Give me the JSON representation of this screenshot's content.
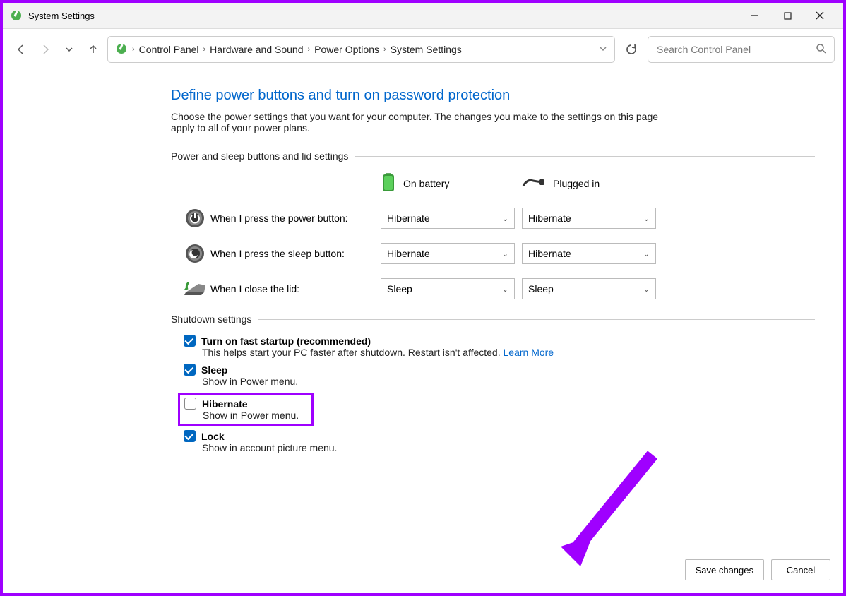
{
  "window": {
    "title": "System Settings"
  },
  "breadcrumb": {
    "items": [
      "Control Panel",
      "Hardware and Sound",
      "Power Options",
      "System Settings"
    ]
  },
  "search": {
    "placeholder": "Search Control Panel"
  },
  "page": {
    "heading": "Define power buttons and turn on password protection",
    "description": "Choose the power settings that you want for your computer. The changes you make to the settings on this page apply to all of your power plans.",
    "section_power_label": "Power and sleep buttons and lid settings",
    "col_battery": "On battery",
    "col_plugged": "Plugged in",
    "rows": {
      "power_button": {
        "label": "When I press the power button:",
        "battery": "Hibernate",
        "plugged": "Hibernate"
      },
      "sleep_button": {
        "label": "When I press the sleep button:",
        "battery": "Hibernate",
        "plugged": "Hibernate"
      },
      "lid": {
        "label": "When I close the lid:",
        "battery": "Sleep",
        "plugged": "Sleep"
      }
    },
    "section_shutdown_label": "Shutdown settings",
    "shutdown": {
      "fast_startup": {
        "title": "Turn on fast startup (recommended)",
        "desc": "This helps start your PC faster after shutdown. Restart isn't affected.",
        "learn_more": "Learn More",
        "checked": true
      },
      "sleep": {
        "title": "Sleep",
        "desc": "Show in Power menu.",
        "checked": true
      },
      "hibernate": {
        "title": "Hibernate",
        "desc": "Show in Power menu.",
        "checked": false
      },
      "lock": {
        "title": "Lock",
        "desc": "Show in account picture menu.",
        "checked": true
      }
    }
  },
  "footer": {
    "save": "Save changes",
    "cancel": "Cancel"
  }
}
